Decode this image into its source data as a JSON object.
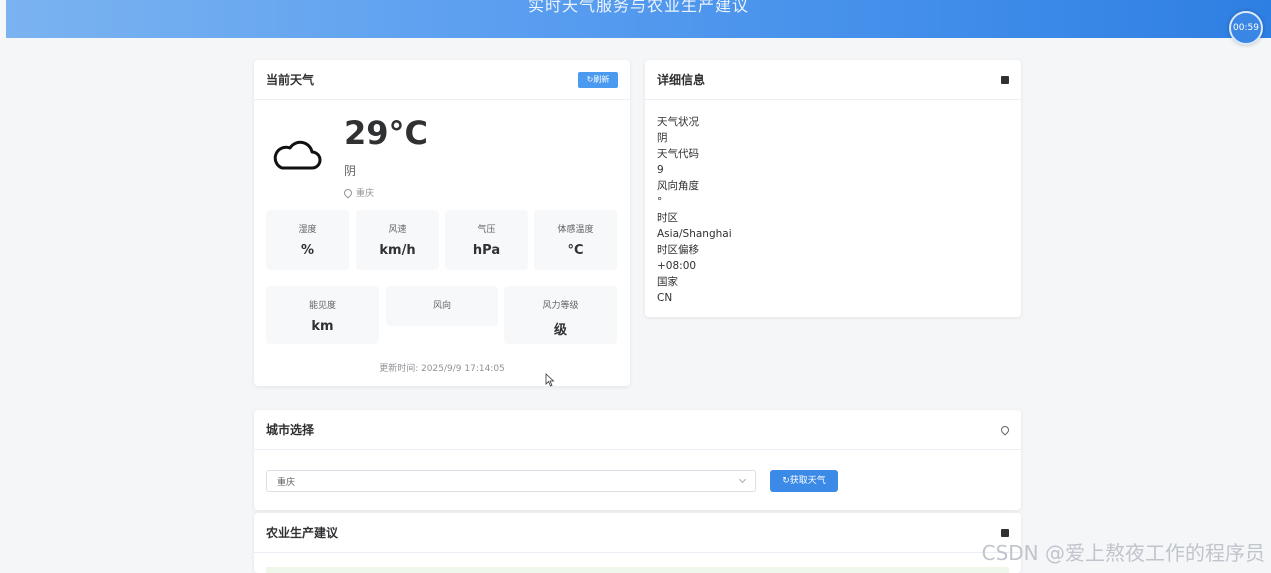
{
  "header": {
    "title": "实时天气服务与农业生产建议",
    "timer": "00:59"
  },
  "current": {
    "title": "当前天气",
    "refresh_label": "↻刷新",
    "temperature": "29°C",
    "condition": "阴",
    "location": "重庆",
    "stats": [
      {
        "label": "湿度",
        "value": "%"
      },
      {
        "label": "风速",
        "value": "km/h"
      },
      {
        "label": "气压",
        "value": "hPa"
      },
      {
        "label": "体感温度",
        "value": "°C"
      },
      {
        "label": "能见度",
        "value": "km"
      },
      {
        "label": "风向",
        "value": ""
      },
      {
        "label": "风力等级",
        "value": "级"
      }
    ],
    "update_time": "更新时间: 2025/9/9 17:14:05"
  },
  "details": {
    "title": "详细信息",
    "lines": [
      "天气状况",
      "阴",
      "天气代码",
      "9",
      "风向角度",
      "°",
      "时区",
      "Asia/Shanghai",
      "时区偏移",
      "+08:00",
      "国家",
      "CN"
    ]
  },
  "city": {
    "title": "城市选择",
    "selected": "重庆",
    "get_label": "↻获取天气"
  },
  "agri": {
    "title": "农业生产建议"
  },
  "watermark": "CSDN @爱上熬夜工作的程序员",
  "colors": {
    "accent": "#3c8ae8",
    "header_start": "#7bb3f0",
    "header_end": "#2e7fe3"
  }
}
